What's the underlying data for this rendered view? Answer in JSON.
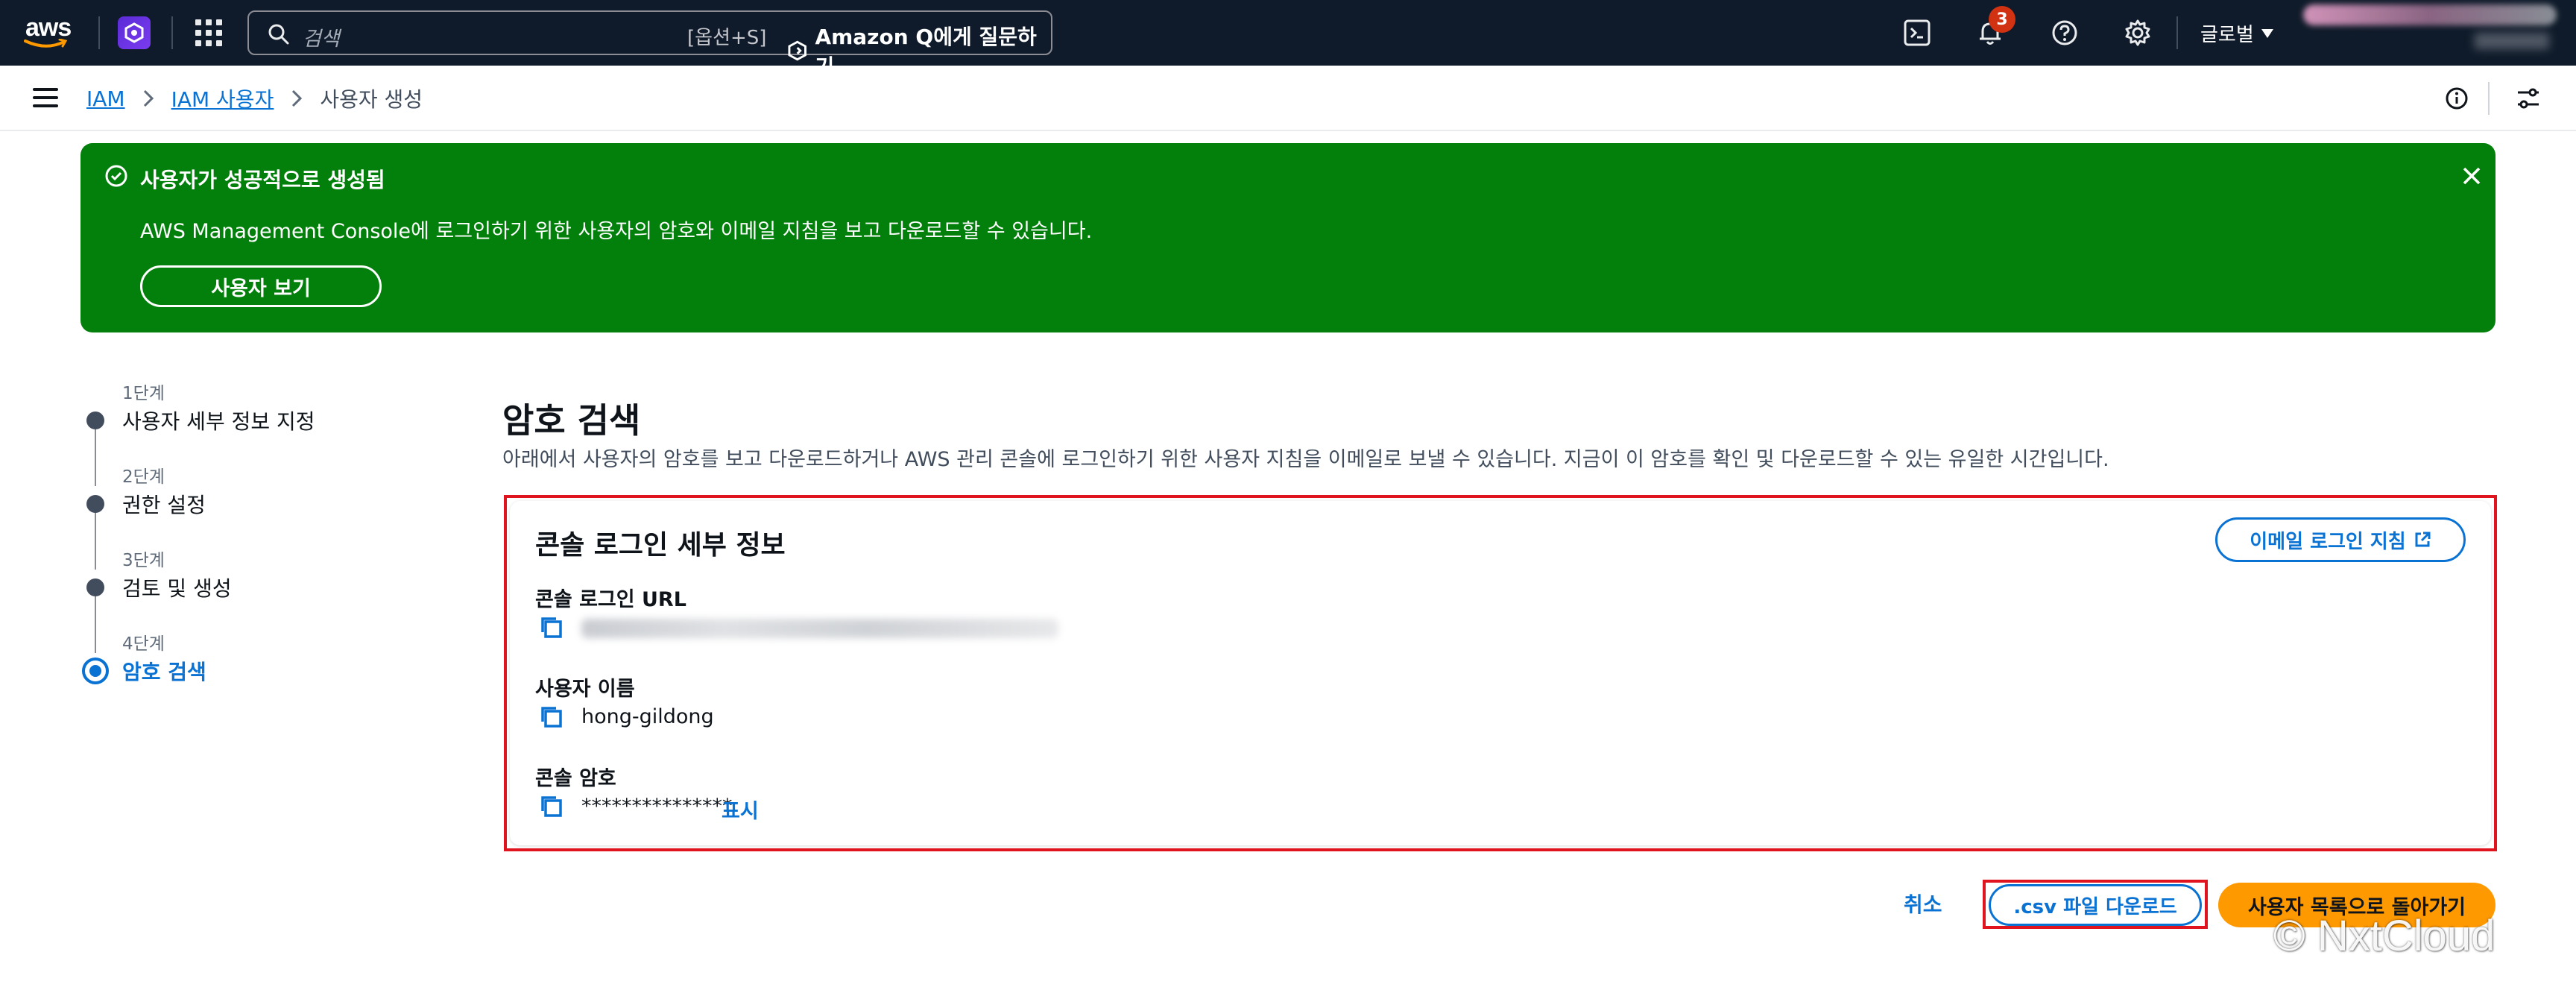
{
  "topnav": {
    "logo_text": "aws",
    "search_placeholder": "검색",
    "search_shortcut": "[옵션+S]",
    "amazon_q_label": "Amazon Q에게 질문하기",
    "notification_count": "3",
    "region_label": "글로벌"
  },
  "breadcrumb": {
    "items": [
      "IAM",
      "IAM 사용자",
      "사용자 생성"
    ]
  },
  "flash": {
    "title": "사용자가 성공적으로 생성됨",
    "message": "AWS Management Console에 로그인하기 위한 사용자의 암호와 이메일 지침을 보고 다운로드할 수 있습니다.",
    "view_user_button": "사용자 보기",
    "color": "#037f0c"
  },
  "steps": [
    {
      "number": "1단계",
      "label": "사용자 세부 정보 지정",
      "active": false
    },
    {
      "number": "2단계",
      "label": "권한 설정",
      "active": false
    },
    {
      "number": "3단계",
      "label": "검토 및 생성",
      "active": false
    },
    {
      "number": "4단계",
      "label": "암호 검색",
      "active": true
    }
  ],
  "main": {
    "title": "암호 검색",
    "description": "아래에서 사용자의 암호를 보고 다운로드하거나 AWS 관리 콘솔에 로그인하기 위한 사용자 지침을 이메일로 보낼 수 있습니다. 지금이 이 암호를 확인 및 다운로드할 수 있는 유일한 시간입니다."
  },
  "panel": {
    "title": "콘솔 로그인 세부 정보",
    "email_button": "이메일 로그인 지침",
    "fields": {
      "url_label": "콘솔 로그인 URL",
      "username_label": "사용자 이름",
      "username_value": "hong-gildong",
      "password_label": "콘솔 암호",
      "password_value": "***************",
      "show_link": "표시"
    }
  },
  "actions": {
    "cancel": "취소",
    "download_csv": ".csv 파일 다운로드",
    "back_to_list": "사용자 목록으로 돌아가기"
  },
  "watermark": "© NxtCloud",
  "colors": {
    "nav_bg": "#0f1b2a",
    "link": "#0972d3",
    "primary": "#ff9900",
    "highlight_border": "#e0141e"
  },
  "icons": [
    "search-icon",
    "amazon-q-icon",
    "cloudshell-icon",
    "bell-icon",
    "help-icon",
    "gear-icon",
    "hamburger-icon",
    "info-icon",
    "check-circle-icon",
    "close-icon",
    "copy-icon",
    "external-link-icon"
  ]
}
